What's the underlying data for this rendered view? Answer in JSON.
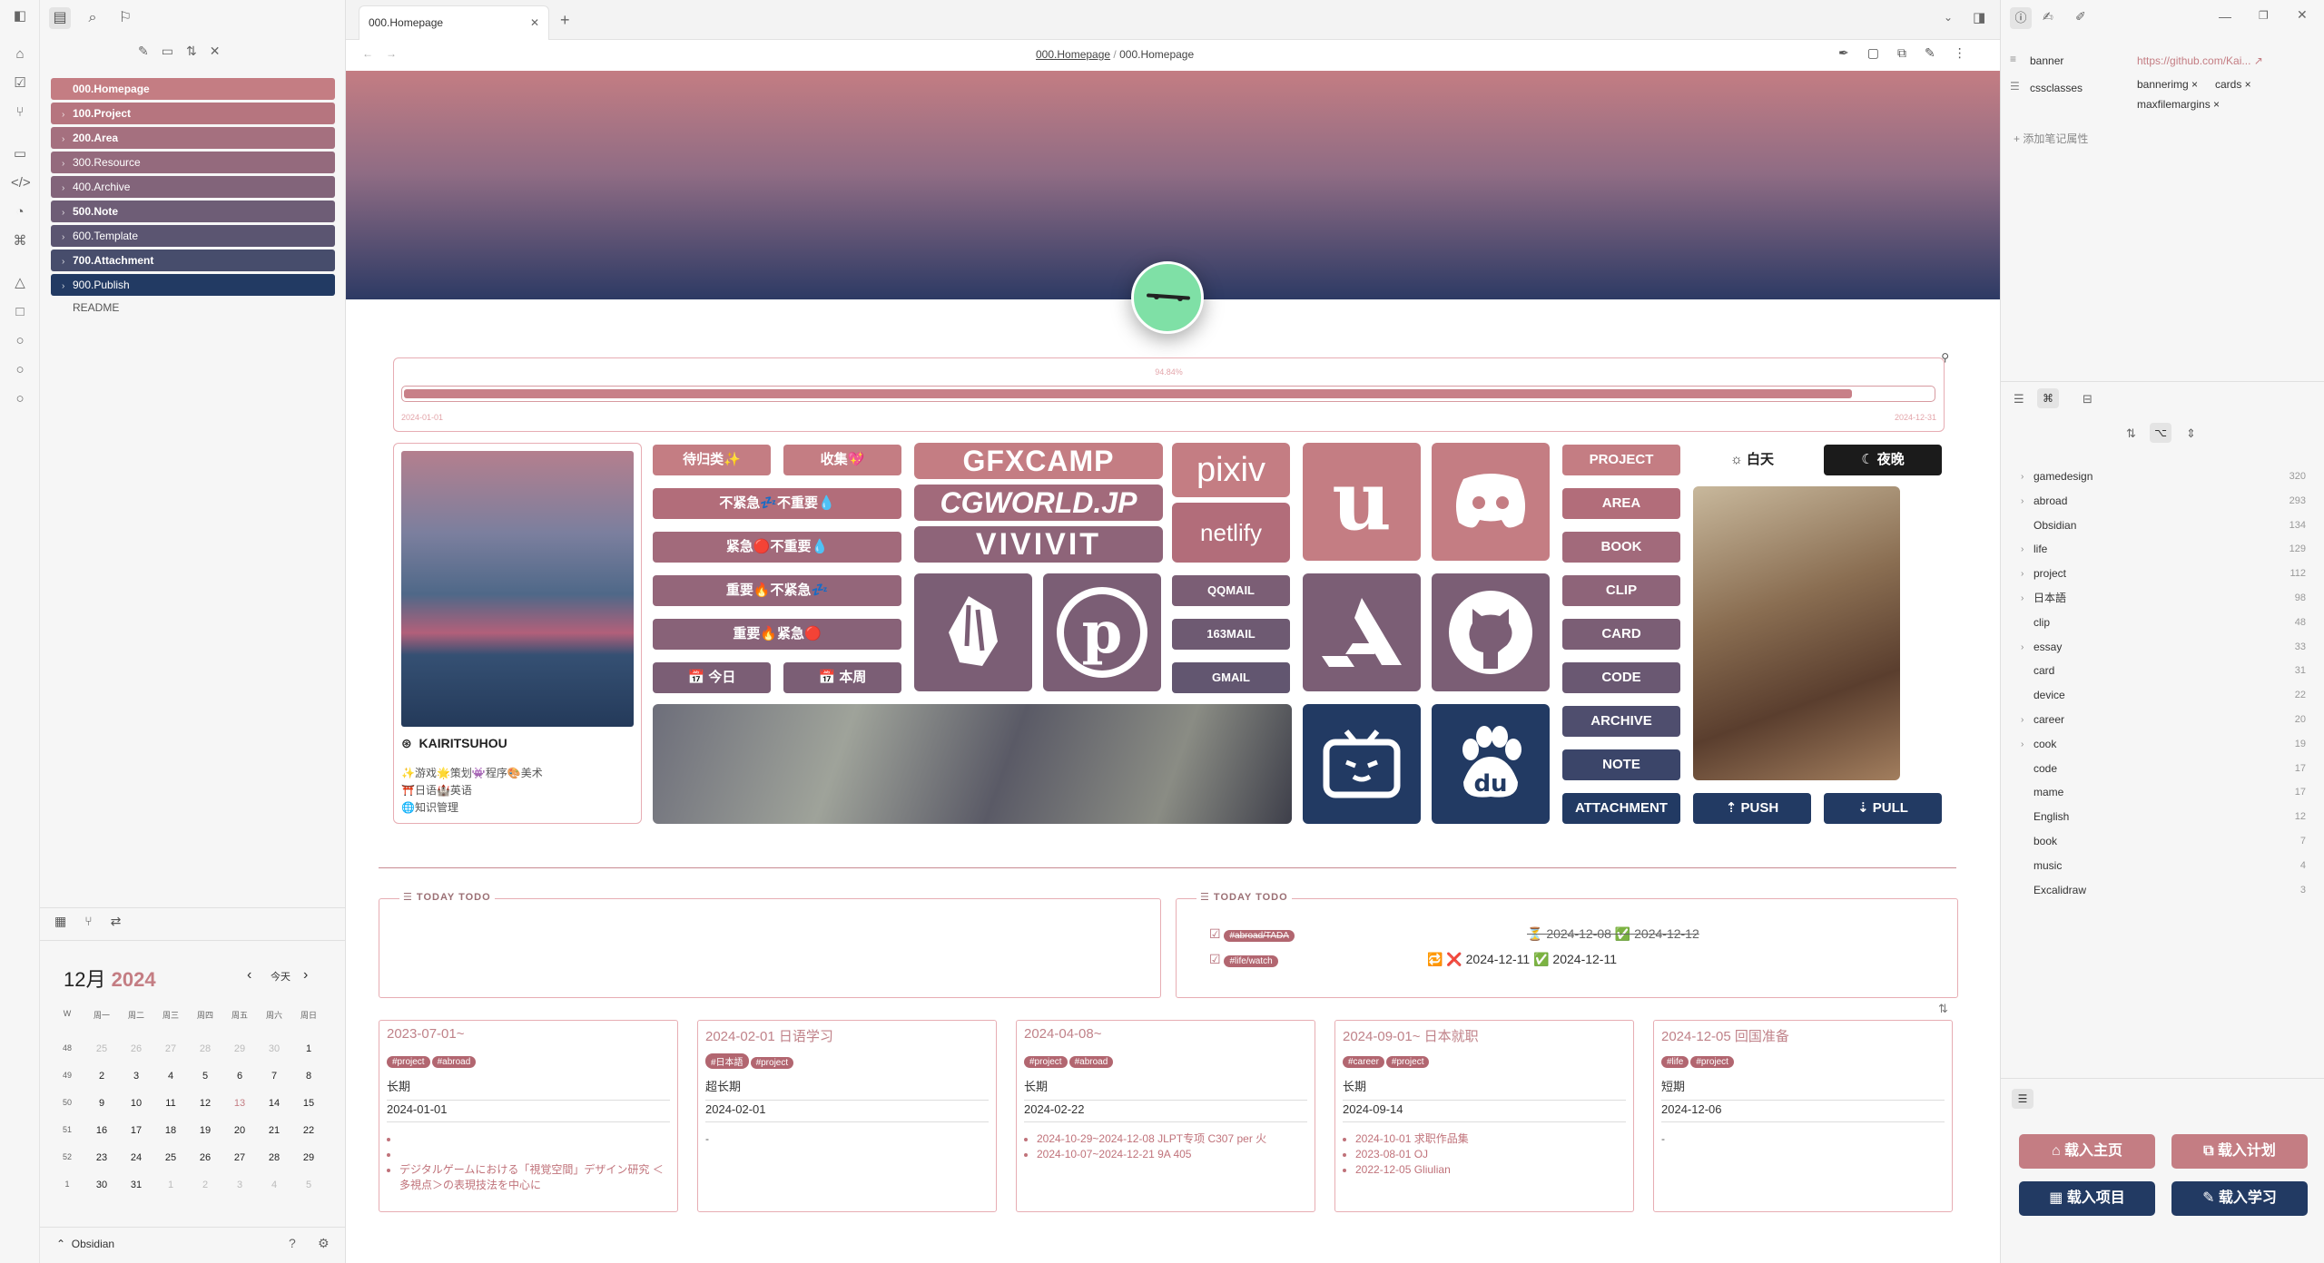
{
  "leftpane": {
    "folders": [
      {
        "label": "000.Homepage",
        "color": "#c47d83",
        "bold": true,
        "chev": ""
      },
      {
        "label": "100.Project",
        "color": "#b6757f",
        "bold": true,
        "chev": "›"
      },
      {
        "label": "200.Area",
        "color": "#a5707f",
        "bold": true,
        "chev": "›"
      },
      {
        "label": "300.Resource",
        "color": "#946a7d",
        "bold": false,
        "chev": "›"
      },
      {
        "label": "400.Archive",
        "color": "#82647a",
        "bold": false,
        "chev": "›"
      },
      {
        "label": "500.Note",
        "color": "#6e5d76",
        "bold": true,
        "chev": "›"
      },
      {
        "label": "600.Template",
        "color": "#5b5571",
        "bold": false,
        "chev": "›"
      },
      {
        "label": "700.Attachment",
        "color": "#474d6c",
        "bold": true,
        "chev": "›"
      },
      {
        "label": "900.Publish",
        "color": "#223a63",
        "bold": false,
        "chev": "›"
      }
    ],
    "readme": "README",
    "vault_name": "Obsidian"
  },
  "calendar": {
    "month": "12月",
    "year": "2024",
    "today_label": "今天",
    "weekday_headers": [
      "W",
      "周一",
      "周二",
      "周三",
      "周四",
      "周五",
      "周六",
      "周日"
    ],
    "weeks": [
      [
        "48",
        "25",
        "26",
        "27",
        "28",
        "29",
        "30",
        "1"
      ],
      [
        "49",
        "2",
        "3",
        "4",
        "5",
        "6",
        "7",
        "8"
      ],
      [
        "50",
        "9",
        "10",
        "11",
        "12",
        "13",
        "14",
        "15"
      ],
      [
        "51",
        "16",
        "17",
        "18",
        "19",
        "20",
        "21",
        "22"
      ],
      [
        "52",
        "23",
        "24",
        "25",
        "26",
        "27",
        "28",
        "29"
      ],
      [
        "1",
        "30",
        "31",
        "1",
        "2",
        "3",
        "4",
        "5"
      ]
    ]
  },
  "tabs": {
    "active": "000.Homepage"
  },
  "breadcrumb": {
    "parent": "000.Homepage",
    "sep": "/",
    "current": "000.Homepage"
  },
  "progress": {
    "percent_label": "94.84%",
    "value": 0.9484,
    "start": "2024-01-01",
    "end": "2024-12-31"
  },
  "profile": {
    "name": "KAIRITSUHOU",
    "line1": "✨游戏🌟策划👾程序🎨美术",
    "line2": "⛩️日语🏰英语",
    "line3": "🌐知识管理"
  },
  "pills": {
    "todo": "待归类✨",
    "fav": "收集💖",
    "q1": "不紧急💤不重要💧",
    "q2": "紧急🔴不重要💧",
    "q3": "重要🔥不紧急💤",
    "q4": "重要🔥紧急🔴",
    "today": "📅 今日",
    "week": "📅 本周"
  },
  "logos": {
    "gfx": "GFXCAMP",
    "cgw": "CGWORLD.JP",
    "vivi": "VIVIVIT",
    "pixiv": "pixiv",
    "netlify": "netlify"
  },
  "mail": {
    "qq": "QQMAIL",
    "n163": "163MAIL",
    "gmail": "GMAIL"
  },
  "nav_buttons": [
    "PROJECT",
    "AREA",
    "BOOK",
    "CLIP",
    "CARD",
    "CODE",
    "ARCHIVE",
    "NOTE",
    "ATTACHMENT"
  ],
  "theme": {
    "day": "☼ 白天",
    "night": "☾ 夜晚"
  },
  "git": {
    "push": "⇡ PUSH",
    "pull": "⇣ PULL"
  },
  "todo_boxes": [
    {
      "title": "TODAY TODO"
    },
    {
      "title": "TODAY TODO",
      "items": [
        {
          "tag": "#abroad/TADA",
          "text": "⏳ 2024-12-08 ✅ 2024-12-12"
        },
        {
          "tag": "#life/watch",
          "text": "🔁 ❌ 2024-12-11 ✅ 2024-12-11"
        }
      ]
    }
  ],
  "project_cards": [
    {
      "title": "2023-07-01~",
      "tags": [
        "#project",
        "#abroad"
      ],
      "type": "长期",
      "date": "2024-01-01",
      "items": [
        "",
        "",
        "デジタルゲームにおける「視覚空間」デザイン研究 ＜多視点＞の表現技法を中心に"
      ]
    },
    {
      "title": "2024-02-01 日语学习",
      "tags": [
        "#日本語",
        "#project"
      ],
      "type": "超长期",
      "date": "2024-02-01",
      "items": [
        "-"
      ]
    },
    {
      "title": "2024-04-08~",
      "tags": [
        "#project",
        "#abroad"
      ],
      "type": "长期",
      "date": "2024-02-22",
      "items": [
        "2024-10-29~2024-12-08 JLPT专项 C307 per 火",
        "2024-10-07~2024-12-21 9A 405"
      ]
    },
    {
      "title": "2024-09-01~ 日本就职",
      "tags": [
        "#career",
        "#project"
      ],
      "type": "长期",
      "date": "2024-09-14",
      "items": [
        "2024-10-01 求职作品集",
        "2023-08-01 OJ",
        "2022-12-05 Gliulian"
      ]
    },
    {
      "title": "2024-12-05 回国准备",
      "tags": [
        "#life",
        "#project"
      ],
      "type": "短期",
      "date": "2024-12-06",
      "items": [
        "-"
      ]
    }
  ],
  "properties": {
    "banner_key": "banner",
    "banner_val": "https://github.com/Kai...",
    "css_key": "cssclasses",
    "css_vals": [
      "bannerimg",
      "cards",
      "maxfilemargins"
    ],
    "add": "+ 添加笔记属性"
  },
  "tag_list": [
    {
      "name": "gamedesign",
      "count": "320",
      "chev": "›"
    },
    {
      "name": "abroad",
      "count": "293",
      "chev": "›"
    },
    {
      "name": "Obsidian",
      "count": "134",
      "chev": ""
    },
    {
      "name": "life",
      "count": "129",
      "chev": "›"
    },
    {
      "name": "project",
      "count": "112",
      "chev": "›"
    },
    {
      "name": "日本語",
      "count": "98",
      "chev": "›"
    },
    {
      "name": "clip",
      "count": "48",
      "chev": ""
    },
    {
      "name": "essay",
      "count": "33",
      "chev": "›"
    },
    {
      "name": "card",
      "count": "31",
      "chev": ""
    },
    {
      "name": "device",
      "count": "22",
      "chev": ""
    },
    {
      "name": "career",
      "count": "20",
      "chev": "›"
    },
    {
      "name": "cook",
      "count": "19",
      "chev": "›"
    },
    {
      "name": "code",
      "count": "17",
      "chev": ""
    },
    {
      "name": "mame",
      "count": "17",
      "chev": ""
    },
    {
      "name": "English",
      "count": "12",
      "chev": ""
    },
    {
      "name": "book",
      "count": "7",
      "chev": ""
    },
    {
      "name": "music",
      "count": "4",
      "chev": ""
    },
    {
      "name": "Excalidraw",
      "count": "3",
      "chev": ""
    }
  ],
  "load_buttons": {
    "home": "⌂ 载入主页",
    "plan": "⧉ 载入计划",
    "proj": "▦ 载入项目",
    "study": "✎ 载入学习"
  }
}
